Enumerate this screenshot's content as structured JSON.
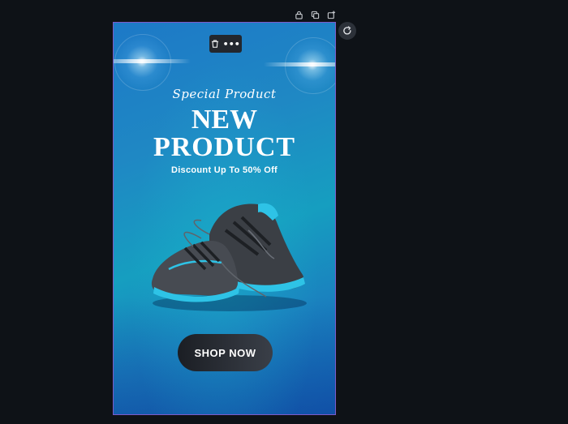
{
  "page_tools": [
    {
      "icon": "lock-icon"
    },
    {
      "icon": "duplicate-icon"
    },
    {
      "icon": "add-page-icon"
    }
  ],
  "refresh": {
    "icon": "refresh-icon"
  },
  "element_toolbar": {
    "delete_icon": "trash-icon",
    "more_label": "•••"
  },
  "design": {
    "script_line": "Special Product",
    "headline_line1": "NEW",
    "headline_line2": "PRODUCT",
    "discount": "Discount Up To 50% Off",
    "cta_label": "SHOP NOW",
    "image": "running-shoes-image"
  },
  "colors": {
    "canvas_border": "#7d5bc9",
    "background_dark": "#0e1217",
    "cta_bg": "#1b1e24",
    "accent_blue": "#1f88c4"
  }
}
